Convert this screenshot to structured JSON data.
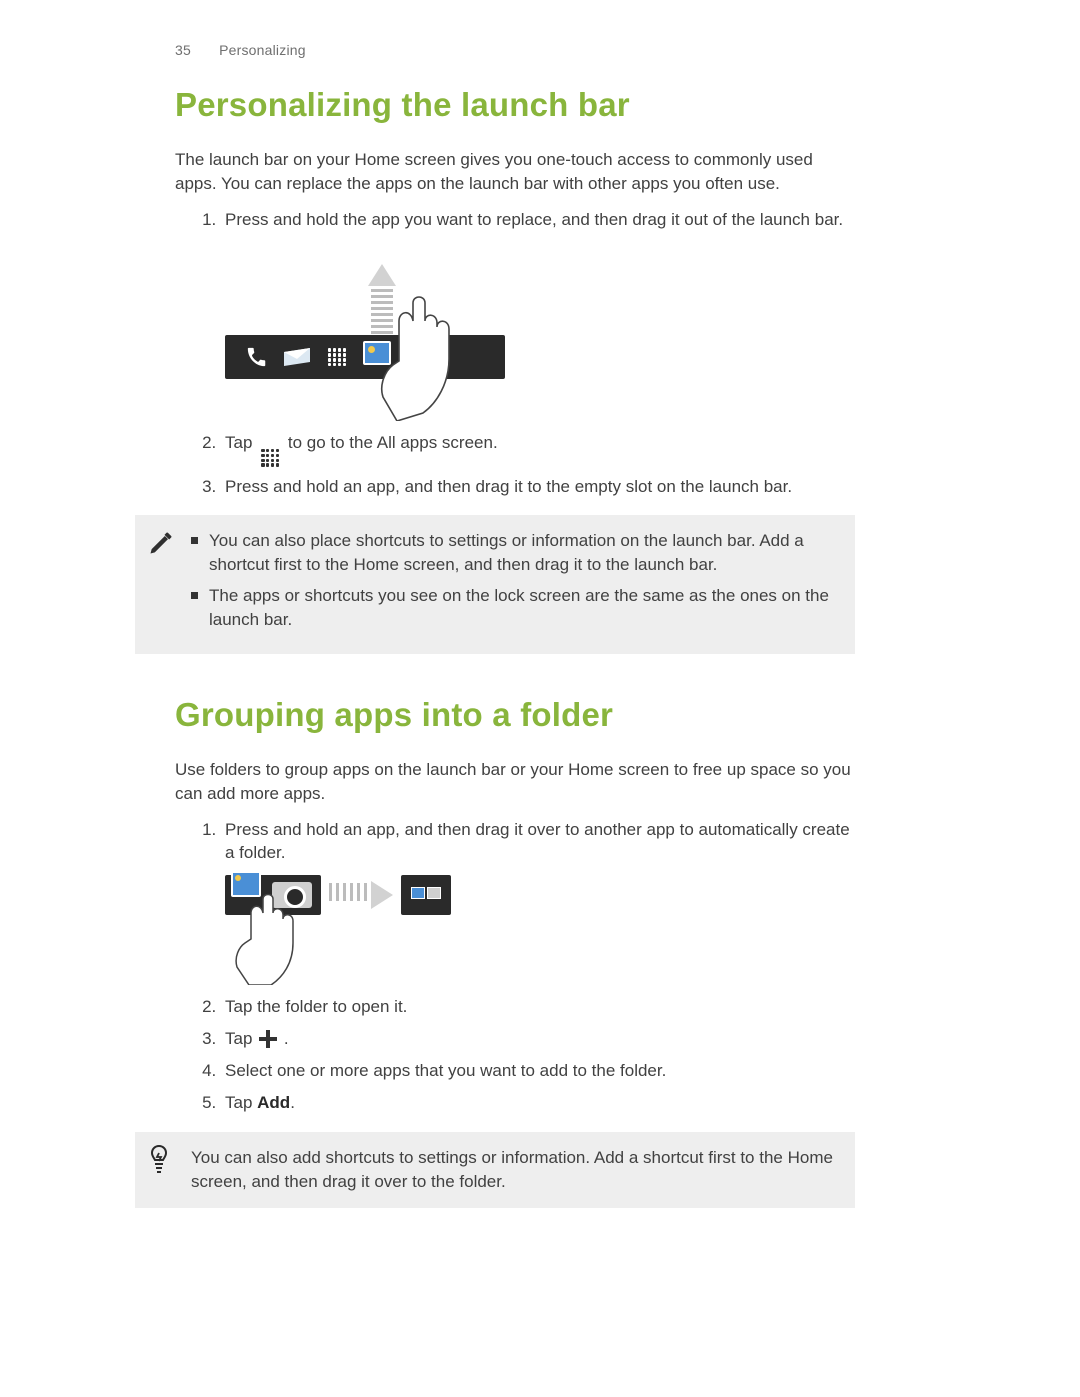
{
  "header": {
    "page_number": "35",
    "section": "Personalizing"
  },
  "section1": {
    "title": "Personalizing the launch bar",
    "intro": "The launch bar on your Home screen gives you one-touch access to commonly used apps. You can replace the apps on the launch bar with other apps you often use.",
    "steps": {
      "s1": "Press and hold the app you want to replace, and then drag it out of the launch bar.",
      "s2a": "Tap ",
      "s2b": " to go to the All apps screen.",
      "s3": "Press and hold an app, and then drag it to the empty slot on the launch bar."
    },
    "note": {
      "b1": "You can also place shortcuts to settings or information on the launch bar. Add a shortcut first to the Home screen, and then drag it to the launch bar.",
      "b2": "The apps or shortcuts you see on the lock screen are the same as the ones on the launch bar."
    }
  },
  "section2": {
    "title": "Grouping apps into a folder",
    "intro": "Use folders to group apps on the launch bar or your Home screen to free up space so you can add more apps.",
    "steps": {
      "s1": "Press and hold an app, and then drag it over to another app to automatically create a folder.",
      "s2": "Tap the folder to open it.",
      "s3a": "Tap ",
      "s3b": ".",
      "s4": "Select one or more apps that you want to add to the folder.",
      "s5a": "Tap ",
      "s5_bold": "Add",
      "s5b": "."
    },
    "tip": "You can also add shortcuts to settings or information. Add a shortcut first to the Home screen, and then drag it over to the folder."
  }
}
